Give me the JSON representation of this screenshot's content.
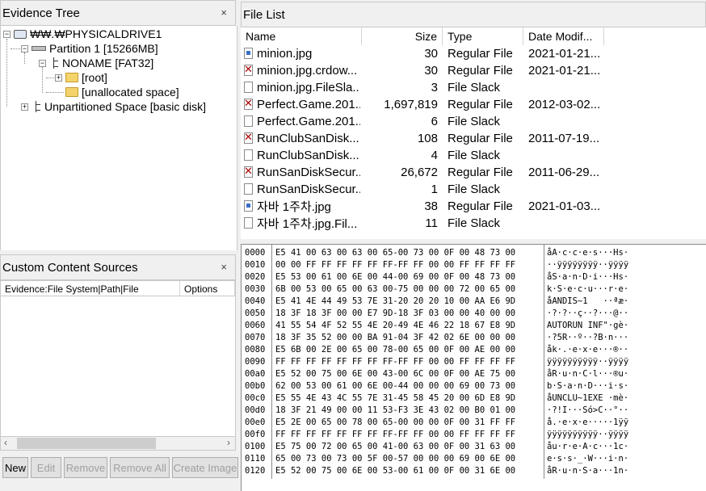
{
  "evidence_tree": {
    "title": "Evidence Tree",
    "close": "×",
    "nodes": [
      {
        "label": "₩₩.₩PHYSICALDRIVE1",
        "expander": "−"
      },
      {
        "label": "Partition 1 [15266MB]",
        "expander": "−"
      },
      {
        "label": "NONAME [FAT32]",
        "expander": "−"
      },
      {
        "label": "[root]",
        "expander": "+"
      },
      {
        "label": "[unallocated space]",
        "expander": ""
      },
      {
        "label": "Unpartitioned Space [basic disk]",
        "expander": "+"
      }
    ]
  },
  "custom_content": {
    "title": "Custom Content Sources",
    "close": "×",
    "columns": [
      "Evidence:File System|Path|File",
      "Options"
    ],
    "scroll_left": "‹",
    "scroll_right": "›",
    "buttons": [
      "New",
      "Edit",
      "Remove",
      "Remove All",
      "Create Image"
    ]
  },
  "file_list": {
    "title": "File List",
    "columns": [
      "Name",
      "Size",
      "Type",
      "Date Modif..."
    ],
    "rows": [
      {
        "icon": "image-file-icon",
        "name": "minion.jpg",
        "size": "30",
        "type": "Regular File",
        "date": "2021-01-21..."
      },
      {
        "icon": "deleted-file-icon",
        "name": "minion.jpg.crdow...",
        "size": "30",
        "type": "Regular File",
        "date": "2021-01-21..."
      },
      {
        "icon": "file-icon",
        "name": "minion.jpg.FileSla...",
        "size": "3",
        "type": "File Slack",
        "date": ""
      },
      {
        "icon": "deleted-file-icon",
        "name": "Perfect.Game.201...",
        "size": "1,697,819",
        "type": "Regular File",
        "date": "2012-03-02..."
      },
      {
        "icon": "file-icon",
        "name": "Perfect.Game.201...",
        "size": "6",
        "type": "File Slack",
        "date": ""
      },
      {
        "icon": "deleted-file-icon",
        "name": "RunClubSanDisk....",
        "size": "108",
        "type": "Regular File",
        "date": "2011-07-19..."
      },
      {
        "icon": "file-icon",
        "name": "RunClubSanDisk....",
        "size": "4",
        "type": "File Slack",
        "date": ""
      },
      {
        "icon": "deleted-file-icon",
        "name": "RunSanDiskSecur...",
        "size": "26,672",
        "type": "Regular File",
        "date": "2011-06-29..."
      },
      {
        "icon": "file-icon",
        "name": "RunSanDiskSecur...",
        "size": "1",
        "type": "File Slack",
        "date": ""
      },
      {
        "icon": "image-file-icon",
        "name": "자바 1주차.jpg",
        "size": "38",
        "type": "Regular File",
        "date": "2021-01-03..."
      },
      {
        "icon": "file-icon",
        "name": "자바 1주차.jpg.Fil...",
        "size": "11",
        "type": "File Slack",
        "date": ""
      }
    ]
  },
  "hex_view": {
    "rows": [
      {
        "off": "0000",
        "hex": "E5 41 00 63 00 63 00 65-00 73 00 0F 00 48 73 00",
        "ascii": "åA·c·c·e·s···Hs·"
      },
      {
        "off": "0010",
        "hex": "00 00 FF FF FF FF FF FF-FF FF 00 00 FF FF FF FF",
        "ascii": "··ÿÿÿÿÿÿÿÿ··ÿÿÿÿ"
      },
      {
        "off": "0020",
        "hex": "E5 53 00 61 00 6E 00 44-00 69 00 0F 00 48 73 00",
        "ascii": "åS·a·n·D·i···Hs·"
      },
      {
        "off": "0030",
        "hex": "6B 00 53 00 65 00 63 00-75 00 00 00 72 00 65 00",
        "ascii": "k·S·e·c·u···r·e·"
      },
      {
        "off": "0040",
        "hex": "E5 41 4E 44 49 53 7E 31-20 20 20 10 00 AA E6 9D",
        "ascii": "åANDIS~1   ··ªæ·"
      },
      {
        "off": "0050",
        "hex": "18 3F 18 3F 00 00 E7 9D-18 3F 03 00 00 40 00 00",
        "ascii": "·?·?··ç··?···@··"
      },
      {
        "off": "0060",
        "hex": "41 55 54 4F 52 55 4E 20-49 4E 46 22 18 67 E8 9D",
        "ascii": "AUTORUN INF\"·gè·"
      },
      {
        "off": "0070",
        "hex": "18 3F 35 52 00 00 BA 91-04 3F 42 02 6E 00 00 00",
        "ascii": "·?5R··º··?B·n···"
      },
      {
        "off": "0080",
        "hex": "E5 6B 00 2E 00 65 00 78-00 65 00 0F 00 AE 00 00",
        "ascii": "åk·.·e·x·e···®··"
      },
      {
        "off": "0090",
        "hex": "FF FF FF FF FF FF FF FF-FF FF 00 00 FF FF FF FF",
        "ascii": "ÿÿÿÿÿÿÿÿÿÿ··ÿÿÿÿ"
      },
      {
        "off": "00a0",
        "hex": "E5 52 00 75 00 6E 00 43-00 6C 00 0F 00 AE 75 00",
        "ascii": "åR·u·n·C·l···®u·"
      },
      {
        "off": "00b0",
        "hex": "62 00 53 00 61 00 6E 00-44 00 00 00 69 00 73 00",
        "ascii": "b·S·a·n·D···i·s·"
      },
      {
        "off": "00c0",
        "hex": "E5 55 4E 43 4C 55 7E 31-45 58 45 20 00 6D E8 9D",
        "ascii": "åUNCLU~1EXE ·mè·"
      },
      {
        "off": "00d0",
        "hex": "18 3F 21 49 00 00 11 53-F3 3E 43 02 00 B0 01 00",
        "ascii": "·?!I···Só>C··°··"
      },
      {
        "off": "00e0",
        "hex": "E5 2E 00 65 00 78 00 65-00 00 00 0F 00 31 FF FF",
        "ascii": "å.·e·x·e·····1ÿÿ"
      },
      {
        "off": "00f0",
        "hex": "FF FF FF FF FF FF FF FF-FF FF 00 00 FF FF FF FF",
        "ascii": "ÿÿÿÿÿÿÿÿÿÿ··ÿÿÿÿ"
      },
      {
        "off": "0100",
        "hex": "E5 75 00 72 00 65 00 41-00 63 00 0F 00 31 63 00",
        "ascii": "åu·r·e·A·c···1c·"
      },
      {
        "off": "0110",
        "hex": "65 00 73 00 73 00 5F 00-57 00 00 00 69 00 6E 00",
        "ascii": "e·s·s·_·W···i·n·"
      },
      {
        "off": "0120",
        "hex": "E5 52 00 75 00 6E 00 53-00 61 00 0F 00 31 6E 00",
        "ascii": "åR·u·n·S·a···1n·"
      }
    ]
  }
}
